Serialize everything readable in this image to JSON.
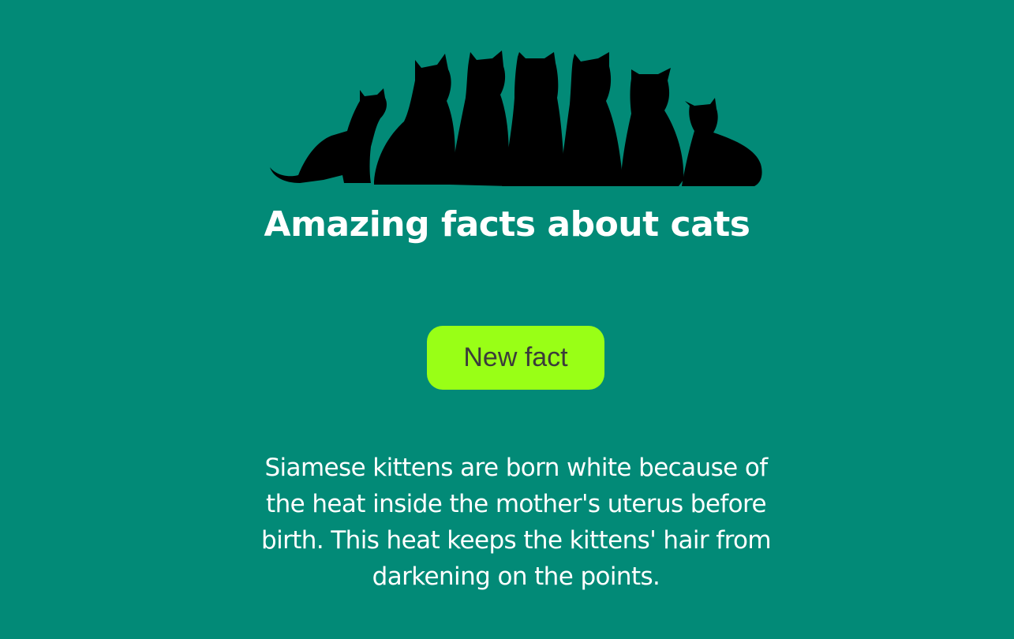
{
  "page": {
    "background_color": "#028a77"
  },
  "header": {
    "image_icon": "cat-silhouettes-icon",
    "title": "Amazing facts about cats"
  },
  "button": {
    "label": "New fact",
    "background_color": "#99ff16",
    "text_color": "#3b3b3b"
  },
  "fact": {
    "text": "Siamese kittens are born white because of the heat inside the mother's uterus before birth. This heat keeps the kittens' hair from darkening on the points."
  }
}
